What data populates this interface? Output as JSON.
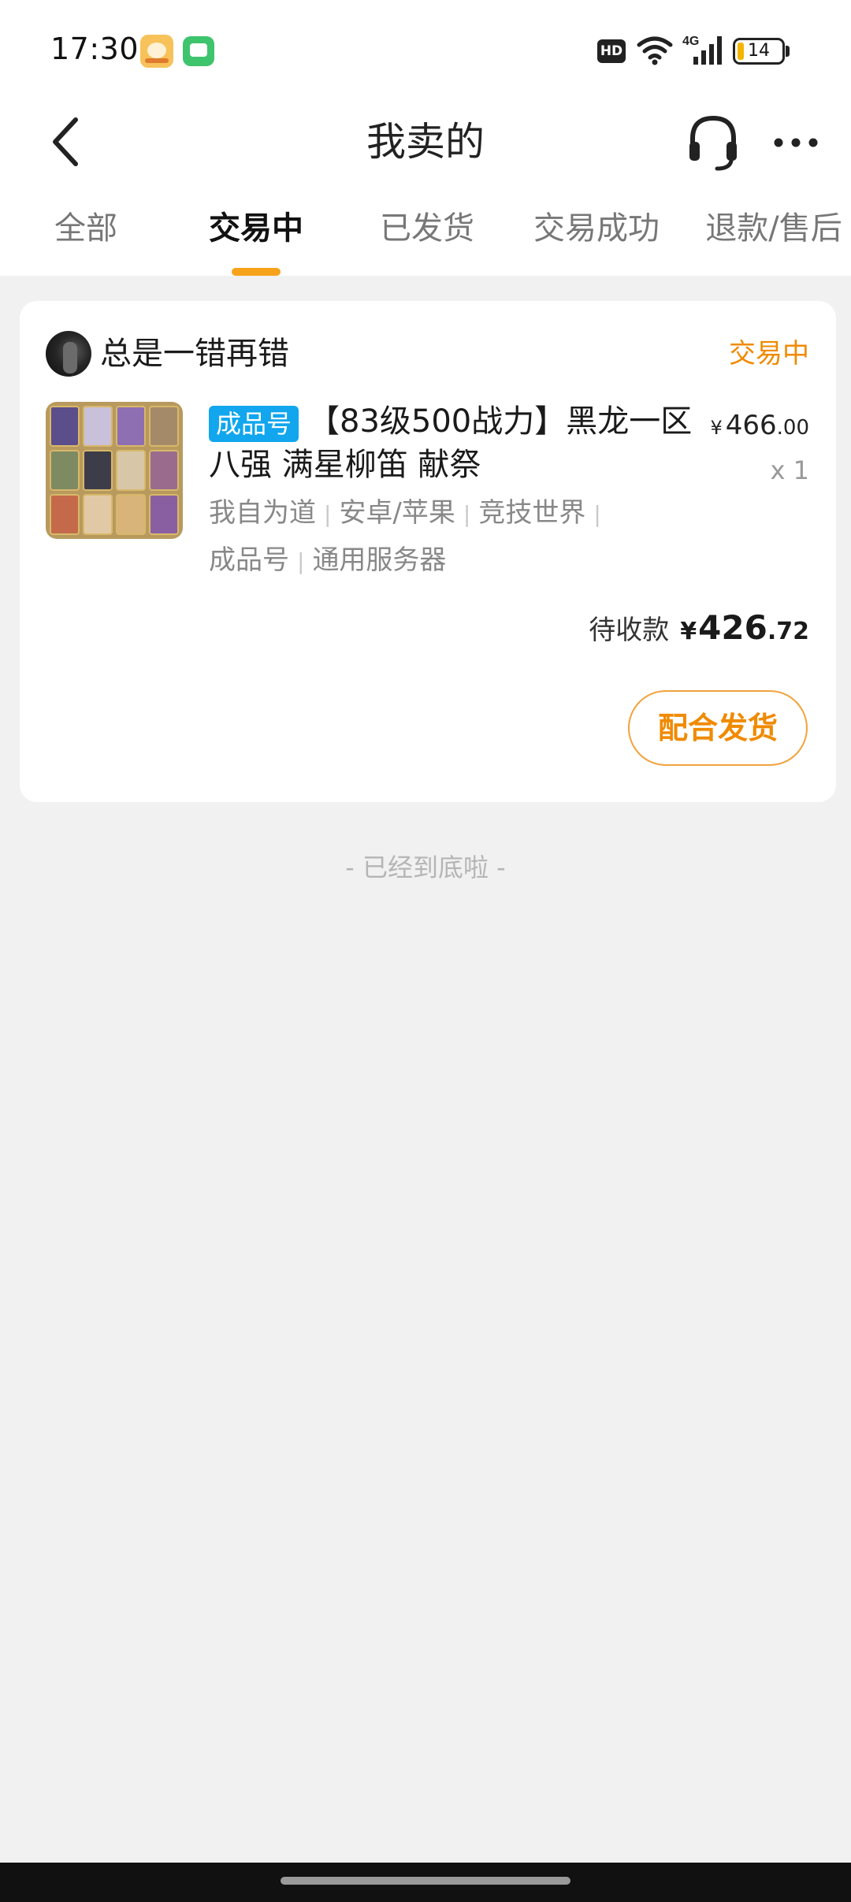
{
  "status_bar": {
    "time": "17:30",
    "hd_label": "HD",
    "network": "4G",
    "battery": "14",
    "icons": [
      "game-app-icon",
      "message-app-icon",
      "wifi-icon",
      "cellular-signal-icon",
      "battery-icon"
    ]
  },
  "nav": {
    "title": "我卖的",
    "icons": [
      "back-arrow-icon",
      "headset-icon",
      "more-dots-icon"
    ]
  },
  "tabs": [
    {
      "label": "全部"
    },
    {
      "label": "交易中"
    },
    {
      "label": "已发货"
    },
    {
      "label": "交易成功"
    },
    {
      "label": "退款/售后"
    }
  ],
  "active_tab": "交易中",
  "order": {
    "buyer_name": "总是一错再错",
    "status": "交易中",
    "badge": "成品号",
    "title": "【83级500战力】黑龙一区八强 满星柳笛 献祭",
    "tags": [
      "我自为道",
      "安卓/苹果",
      "竞技世界",
      "成品号",
      "通用服务器"
    ],
    "tag_separator": "|",
    "price_symbol": "¥",
    "price_integer": "466",
    "price_decimal": ".00",
    "quantity": "x 1",
    "receivable_label": "待收款",
    "receivable_symbol": "¥",
    "receivable_integer": "426",
    "receivable_decimal": ".72",
    "action_label": "配合发货"
  },
  "footer_text": "- 已经到底啦 -",
  "colors": {
    "accent": "#f08a00",
    "tab_indicator": "#f7a21b",
    "badge": "#11a6ee",
    "background": "#f1f1f1"
  }
}
